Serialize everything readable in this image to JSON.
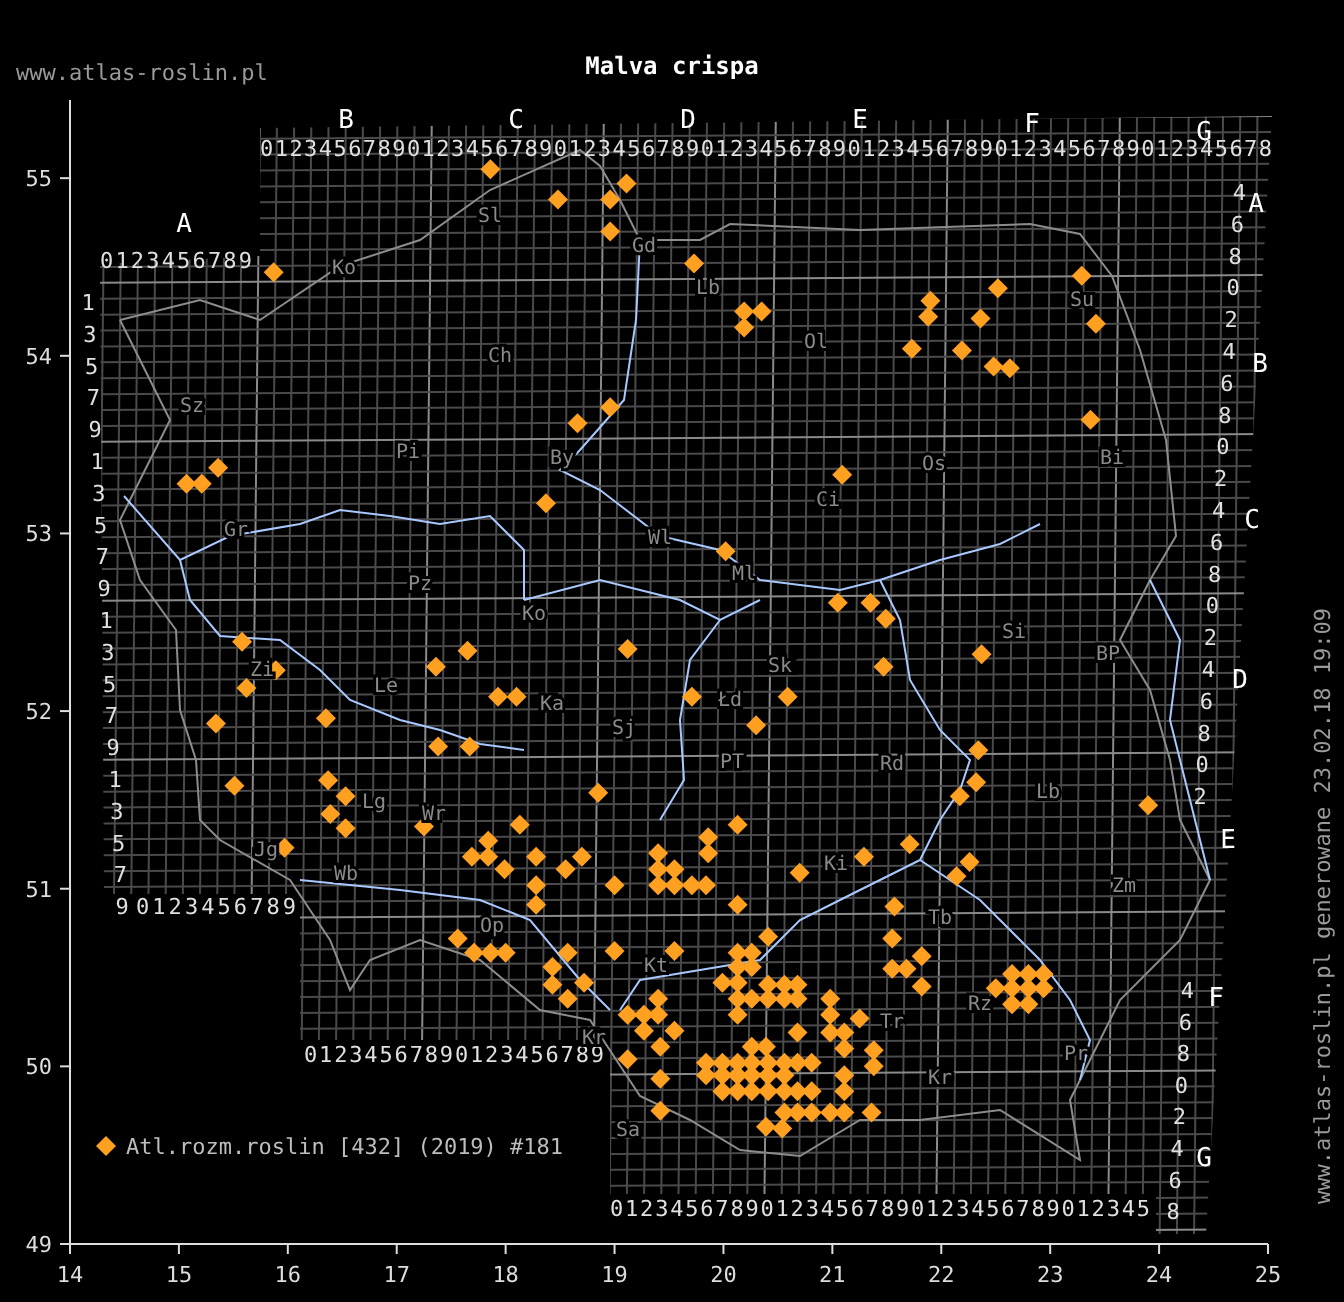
{
  "title": "Malva crispa",
  "site_label": "www.atlas-roslin.pl",
  "credit": "www.atlas-roslin.pl generowane 23.02.18 19:09",
  "column_letters": [
    "A",
    "B",
    "C",
    "D",
    "E",
    "F",
    "G"
  ],
  "row_letters": [
    "A",
    "B",
    "C",
    "D",
    "E",
    "F",
    "G"
  ],
  "column_digit_rows": [
    "0123456789",
    "012345678901234567890123456789012345678901234567890123456789012345678",
    "0123456789",
    "01234567890123456789",
    "012345678901234567890123456789012345"
  ],
  "left_row_digits": [
    "1",
    "3",
    "5",
    "7",
    "9",
    "1",
    "3",
    "5",
    "7",
    "9",
    "1",
    "3",
    "5",
    "7",
    "9",
    "1",
    "3",
    "5",
    "7",
    "9"
  ],
  "right_row_digits": [
    "4",
    "6",
    "8",
    "0",
    "2",
    "4",
    "6",
    "8",
    "0",
    "2",
    "4",
    "6",
    "8",
    "0",
    "2",
    "4",
    "6",
    "8",
    "0",
    "2",
    "4",
    "6",
    "8",
    "0",
    "2",
    "4",
    "6",
    "8"
  ],
  "region_labels": [
    "Ko",
    "Sl",
    "Gd",
    "Lb",
    "Ch",
    "Ol",
    "Su",
    "Sz",
    "Pi",
    "By",
    "Os",
    "Bi",
    "Ci",
    "Gr",
    "Wl",
    "Ml",
    "Pz",
    "Ko",
    "Si",
    "BP",
    "Sk",
    "Zi",
    "Le",
    "Ka",
    "Łd",
    "Sj",
    "PT",
    "Rd",
    "Lb",
    "Lg",
    "Wr",
    "Jg",
    "Ki",
    "Wb",
    "Zm",
    "Op",
    "Tb",
    "Kt",
    "Tr",
    "Rz",
    "Kr",
    "Kr",
    "Pr",
    "Sa"
  ],
  "chart_data": {
    "type": "scatter",
    "xlim": [
      14,
      25
    ],
    "ylim": [
      49,
      55.44
    ],
    "xticks": [
      {
        "value": 14,
        "label": "14"
      },
      {
        "value": 15,
        "label": "15"
      },
      {
        "value": 16,
        "label": "16"
      },
      {
        "value": 17,
        "label": "17"
      },
      {
        "value": 18,
        "label": "18"
      },
      {
        "value": 19,
        "label": "19"
      },
      {
        "value": 20,
        "label": "20"
      },
      {
        "value": 21,
        "label": "21"
      },
      {
        "value": 22,
        "label": "22"
      },
      {
        "value": 23,
        "label": "23"
      },
      {
        "value": 24,
        "label": "24"
      },
      {
        "value": 25,
        "label": "25"
      }
    ],
    "yticks": [
      {
        "value": 49,
        "label": "49"
      },
      {
        "value": 50,
        "label": "50"
      },
      {
        "value": 51,
        "label": "51"
      },
      {
        "value": 52,
        "label": "52"
      },
      {
        "value": 53,
        "label": "53"
      },
      {
        "value": 54,
        "label": "54"
      },
      {
        "value": 55,
        "label": "55"
      }
    ],
    "x": [
      17.86,
      18.48,
      18.96,
      19.11,
      18.96,
      15.87,
      19.73,
      20.19,
      20.35,
      20.19,
      21.9,
      21.88,
      22.52,
      22.36,
      21.73,
      22.19,
      22.48,
      22.63,
      23.29,
      23.42,
      23.37,
      18.96,
      18.66,
      18.37,
      15.36,
      15.07,
      15.21,
      21.09,
      20.02,
      21.05,
      21.35,
      21.49,
      22.37,
      21.47,
      19.71,
      20.59,
      20.3,
      22.34,
      22.32,
      22.17,
      23.9,
      20.13,
      19.86,
      19.86,
      21.71,
      21.29,
      20.7,
      22.26,
      22.14,
      19.71,
      19.84,
      20.13,
      21.57,
      20.41,
      21.55,
      19.55,
      20.13,
      20.26,
      21.82,
      20.13,
      20.26,
      21.55,
      21.68,
      19.99,
      20.13,
      20.41,
      20.56,
      20.68,
      21.82,
      22.65,
      22.8,
      22.94,
      22.5,
      22.65,
      22.8,
      22.94,
      22.65,
      22.8,
      20.13,
      20.26,
      20.41,
      20.56,
      20.68,
      20.98,
      20.13,
      20.98,
      21.25,
      20.68,
      20.98,
      21.11,
      21.11,
      20.26,
      20.39,
      21.38,
      21.38,
      19.84,
      19.99,
      20.13,
      20.26,
      20.41,
      20.56,
      20.68,
      20.81,
      19.84,
      19.99,
      20.13,
      20.26,
      20.41,
      20.56,
      21.11,
      19.99,
      20.13,
      20.26,
      20.41,
      20.56,
      20.68,
      20.81,
      21.11,
      20.56,
      20.68,
      20.81,
      20.98,
      21.11,
      21.36,
      20.39,
      20.54,
      15.58,
      17.65,
      19.12,
      17.36,
      15.89,
      15.62,
      17.93,
      18.1,
      16.35,
      15.34,
      17.38,
      17.67,
      18.85,
      15.51,
      16.37,
      16.53,
      16.39,
      16.53,
      17.25,
      18.13,
      15.97,
      17.84,
      17.69,
      17.84,
      18.28,
      18.7,
      17.99,
      18.55,
      18.28,
      18.28,
      19.0,
      19.4,
      19.4,
      19.55,
      19.4,
      19.55,
      17.56,
      17.71,
      17.86,
      18.0,
      18.43,
      18.43,
      18.57,
      18.72,
      18.57,
      19.0,
      19.4,
      19.12,
      19.27,
      19.4,
      19.27,
      19.55,
      19.42,
      19.12,
      19.42,
      19.42
    ],
    "series": [
      {
        "name": "Atl.rozm.roslin [432] (2019) #181",
        "color": "#ffa020",
        "values": [
          55.05,
          54.88,
          54.88,
          54.97,
          54.7,
          54.47,
          54.52,
          54.25,
          54.25,
          54.16,
          54.31,
          54.22,
          54.38,
          54.21,
          54.04,
          54.03,
          53.94,
          53.93,
          54.45,
          54.18,
          53.64,
          53.71,
          53.62,
          53.17,
          53.37,
          53.28,
          53.28,
          53.33,
          52.9,
          52.61,
          52.61,
          52.52,
          52.32,
          52.25,
          52.08,
          52.08,
          51.92,
          51.78,
          51.6,
          51.52,
          51.47,
          51.36,
          51.29,
          51.2,
          51.25,
          51.18,
          51.09,
          51.15,
          51.07,
          51.02,
          51.02,
          50.91,
          50.9,
          50.73,
          50.72,
          50.65,
          50.64,
          50.64,
          50.62,
          50.56,
          50.56,
          50.55,
          50.55,
          50.47,
          50.47,
          50.46,
          50.46,
          50.46,
          50.45,
          50.52,
          50.52,
          50.52,
          50.44,
          50.44,
          50.44,
          50.44,
          50.35,
          50.35,
          50.38,
          50.38,
          50.38,
          50.38,
          50.38,
          50.38,
          50.29,
          50.29,
          50.27,
          50.19,
          50.19,
          50.19,
          50.1,
          50.11,
          50.11,
          50.09,
          50.0,
          50.02,
          50.02,
          50.02,
          50.02,
          50.02,
          50.02,
          50.02,
          50.02,
          49.95,
          49.95,
          49.95,
          49.95,
          49.95,
          49.95,
          49.95,
          49.86,
          49.86,
          49.86,
          49.86,
          49.86,
          49.86,
          49.86,
          49.86,
          49.74,
          49.74,
          49.74,
          49.74,
          49.74,
          49.74,
          49.66,
          49.65,
          52.39,
          52.34,
          52.35,
          52.25,
          52.23,
          52.13,
          52.08,
          52.08,
          51.96,
          51.93,
          51.8,
          51.8,
          51.54,
          51.58,
          51.61,
          51.52,
          51.42,
          51.34,
          51.35,
          51.36,
          51.23,
          51.27,
          51.18,
          51.18,
          51.18,
          51.18,
          51.11,
          51.11,
          51.02,
          50.91,
          51.02,
          51.2,
          51.11,
          51.11,
          51.02,
          51.02,
          50.72,
          50.64,
          50.64,
          50.64,
          50.56,
          50.46,
          50.64,
          50.47,
          50.38,
          50.65,
          50.38,
          50.29,
          50.29,
          50.29,
          50.2,
          50.2,
          50.11,
          50.04,
          49.93,
          49.75
        ]
      }
    ]
  }
}
